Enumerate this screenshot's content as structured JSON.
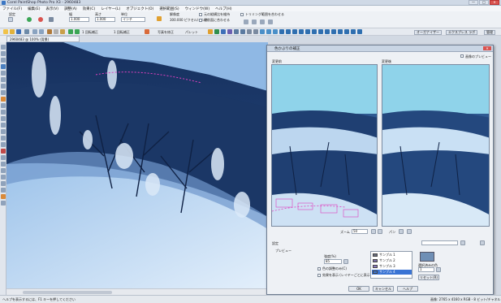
{
  "app": {
    "title": "Corel PaintShop Photo Pro X3 - 2960483"
  },
  "window_buttons": [
    "—",
    "□",
    "✕"
  ],
  "menu": [
    "ファイル(F)",
    "編集(E)",
    "表示(V)",
    "調整(A)",
    "効果(C)",
    "レイヤー(L)",
    "オブジェクト(O)",
    "選択範囲(S)",
    "ウィンドウ(W)",
    "ヘルプ(H)"
  ],
  "tool_options": {
    "preset_label": "設定",
    "width_label": "幅",
    "width_value": "1.000",
    "height_label": "高さ",
    "height_value": "1.000",
    "unit_label": "単位",
    "unit_value": "インチ",
    "resolution_label": "解像度",
    "resolution_value": "300.000 ピクセル/インチ",
    "opt1": "元の縦横比を維持",
    "opt2": "最前面に合わせる",
    "opt3": "トリミング範囲を合わせる"
  },
  "toolbar2": {
    "zoom_btn": "1 回転補正",
    "size_btn": "1 回転補正",
    "photo_btn": "写真を修正",
    "palette_btn": "パレット"
  },
  "right_top": {
    "organizer": "オーガナイザー",
    "express": "エクスプレス ラボ",
    "manage": "管理"
  },
  "doc_tab": "2960483 @ 100% (背景)",
  "dialog": {
    "title": "色かぶりの補正",
    "preview_check": "画像のプレビュー",
    "before_label": "変更前",
    "after_label": "変更後",
    "zoom_label": "ズーム",
    "zoom_value": "50",
    "pan_label": "パン",
    "preset_label": "設定",
    "preview_section": "プレビュー",
    "strength_label": "強度(%)",
    "strength_value": "85",
    "opt_all_colors": "色の調整のみ(C)",
    "opt_sharp": "効果を表示 (レイヤーごとに表示)",
    "samples": [
      "サンプル 1",
      "サンプル 2",
      "サンプル 3",
      "サンプル 4"
    ],
    "sample_colors": [
      "#6a6f80",
      "#7a6ea6",
      "#8a7ac0",
      "#3a74d4"
    ],
    "selected_color_label": "選択済みの色",
    "selected_value": "1",
    "reset_btn": "リセット(R)",
    "ok": "OK",
    "cancel": "キャンセル",
    "help": "ヘルプ"
  },
  "status": {
    "left": "ヘルプを表示するには、F1 キーを押してください",
    "right": "画像: 2765 x 4160 x RGB - 8 ビット/チャネル"
  },
  "colors": {
    "accent": "#3a74d4",
    "sky": "#8fd3ea",
    "mountain": "#1b3766",
    "snow": "#cfe2f5"
  }
}
